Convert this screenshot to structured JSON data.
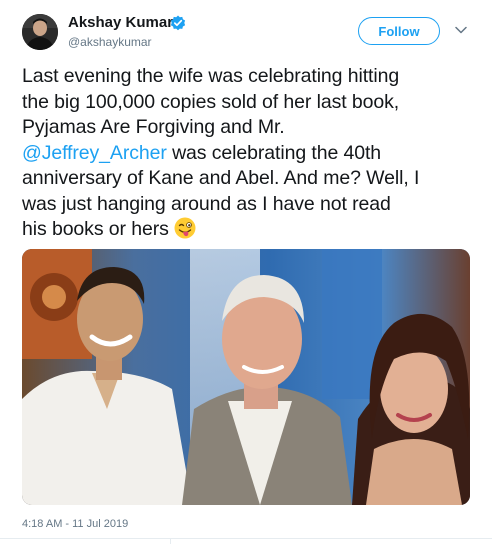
{
  "author": {
    "name": "Akshay Kumar",
    "handle": "@akshaykumar",
    "verified": true
  },
  "follow_button": {
    "label": "Follow"
  },
  "tweet": {
    "line1": "Last evening the wife was celebrating hitting",
    "line2": "the big 100,000 copies sold of her last book,",
    "line3": "Pyjamas Are Forgiving and Mr.",
    "mention": "@Jeffrey_Archer",
    "line4_rest": " was celebrating the 40th",
    "line5": "anniversary of Kane and Abel. And me? Well, I",
    "line6": "was just hanging around as I have not read",
    "line7": "his books or hers",
    "emoji": "winking-face-with-tongue"
  },
  "photo": {
    "people": [
      "man-left",
      "elderly-man-center",
      "woman-right"
    ]
  },
  "timestamp": "4:18 AM - 11 Jul 2019",
  "colors": {
    "accent": "#1da1f2",
    "text": "#14171a",
    "muted": "#657786"
  }
}
